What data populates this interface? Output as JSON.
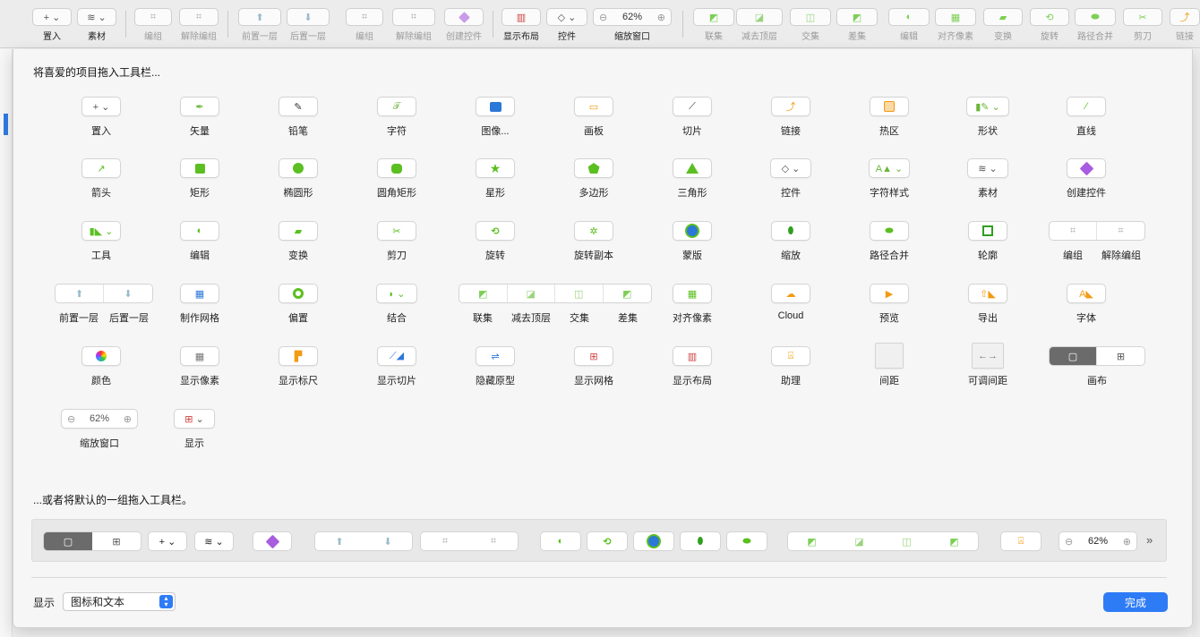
{
  "toolbar": {
    "insert": "置入",
    "assets": "素材",
    "group": "编组",
    "ungroup": "解除编组",
    "forward": "前置一层",
    "backward": "后置一层",
    "group2": "编组",
    "ungroup2": "解除编组",
    "create_symbol": "创建控件",
    "show_layout": "显示布局",
    "symbols": "控件",
    "zoom": "缩放窗口",
    "zoom_value": "62%",
    "union": "联集",
    "subtract": "减去顶层",
    "intersect": "交集",
    "difference": "差集",
    "edit": "编辑",
    "pixel_align": "对齐像素",
    "transform": "变换",
    "rotate": "旋转",
    "flatten": "路径合并",
    "scissors": "剪刀",
    "link": "链接"
  },
  "sheet": {
    "drag_heading": "将喜爱的项目拖入工具栏...",
    "default_heading": "...或者将默认的一组拖入工具栏。",
    "show_label": "显示",
    "show_value": "图标和文本",
    "done": "完成"
  },
  "palette": {
    "row1": [
      "置入",
      "矢量",
      "铅笔",
      "字符",
      "图像...",
      "画板",
      "切片",
      "链接",
      "热区",
      "形状",
      "直线"
    ],
    "row2": [
      "箭头",
      "矩形",
      "椭圆形",
      "圆角矩形",
      "星形",
      "多边形",
      "三角形",
      "控件",
      "字符样式",
      "素材",
      "创建控件"
    ],
    "row3": [
      "工具",
      "编辑",
      "变换",
      "剪刀",
      "旋转",
      "旋转副本",
      "蒙版",
      "缩放",
      "路径合并",
      "轮廓",
      "编组",
      "解除编组"
    ],
    "row4": [
      "前置一层",
      "后置一层",
      "制作网格",
      "偏置",
      "结合",
      "联集",
      "减去顶层",
      "交集",
      "差集",
      "对齐像素",
      "Cloud",
      "预览",
      "导出",
      "字体"
    ],
    "row5": [
      "颜色",
      "显示像素",
      "显示标尺",
      "显示切片",
      "隐藏原型",
      "显示网格",
      "显示布局",
      "助理",
      "间距",
      "可调间距",
      "画布"
    ],
    "row6": [
      "缩放窗口",
      "显示"
    ],
    "zoom_value": "62%"
  },
  "default_bar": {
    "zoom_value": "62%",
    "more": "»"
  },
  "colors": {
    "accent": "#2e7bf6",
    "green": "#5bbf21",
    "orange": "#f29b12",
    "purple": "#a85ce0"
  }
}
